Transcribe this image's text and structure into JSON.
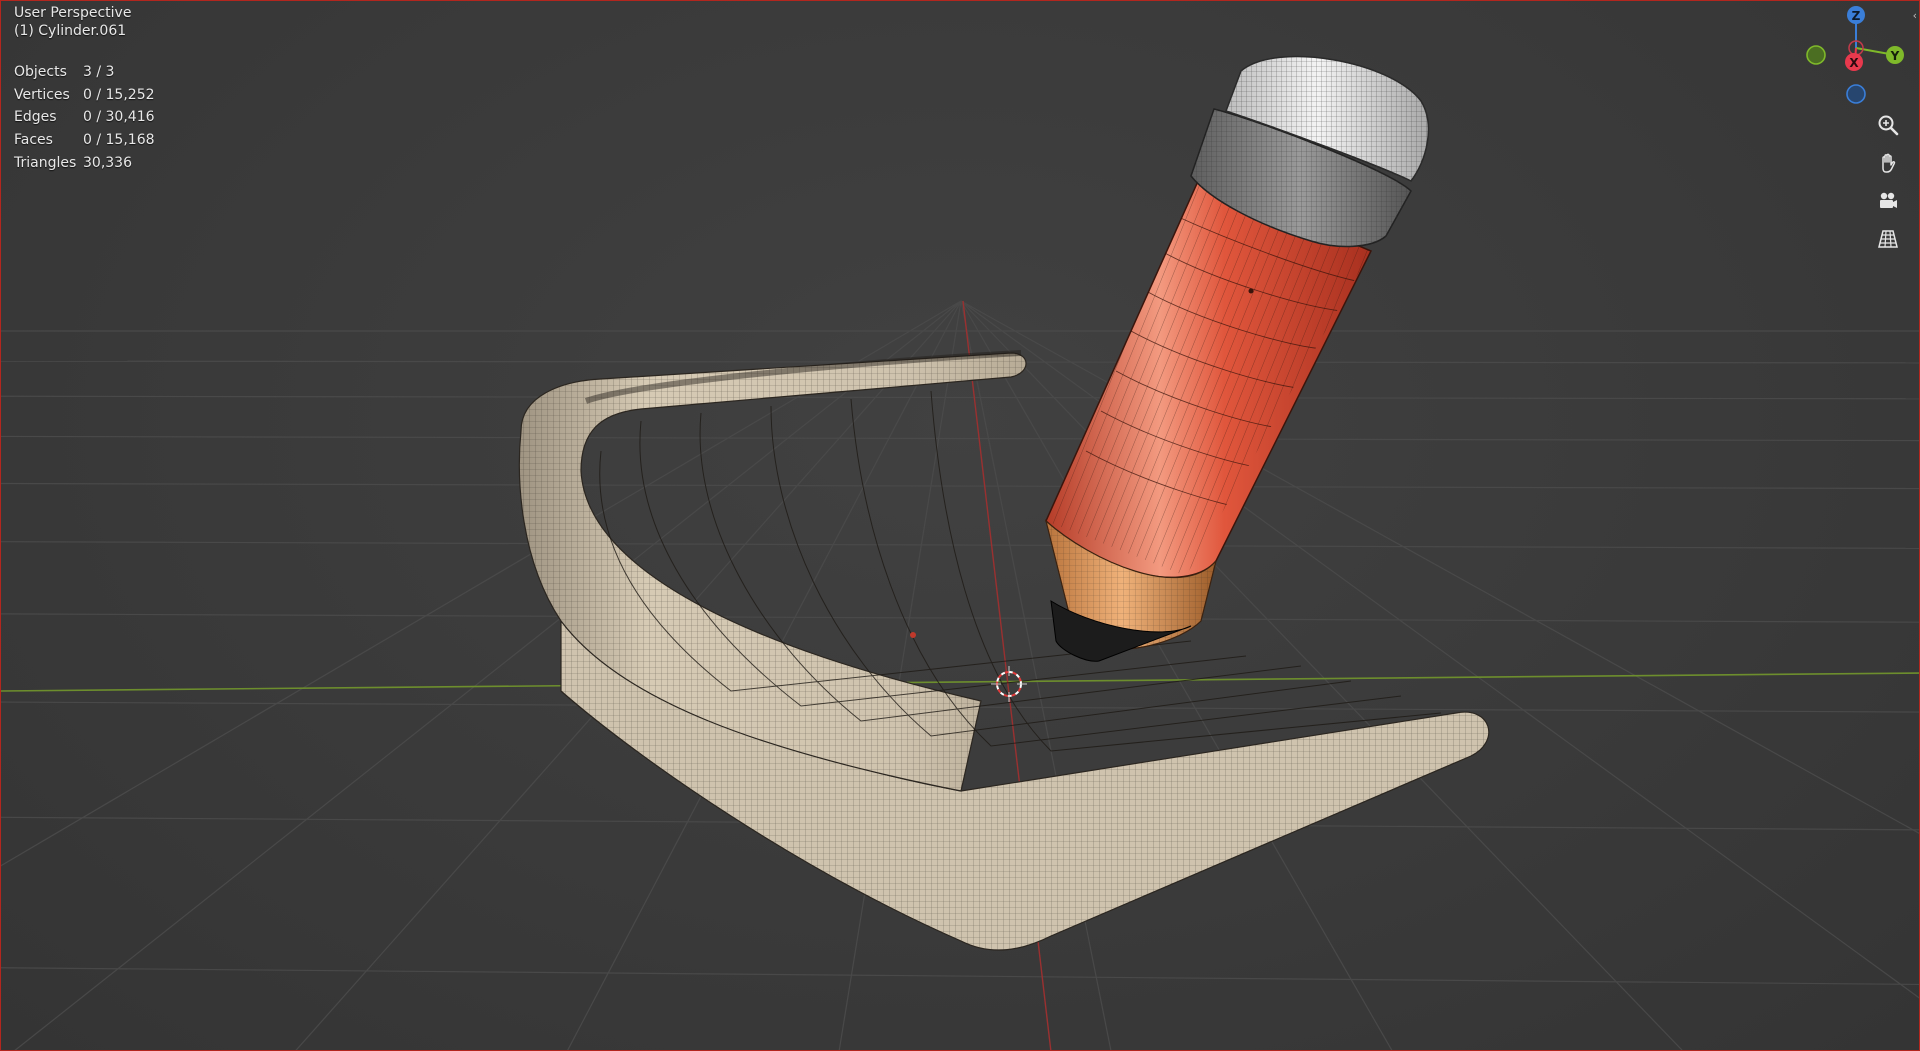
{
  "viewport": {
    "view_name": "User Perspective",
    "active_object": "(1) Cylinder.061"
  },
  "stats": [
    {
      "label": "Objects",
      "value": "3 / 3"
    },
    {
      "label": "Vertices",
      "value": "0 / 15,252"
    },
    {
      "label": "Edges",
      "value": "0 / 30,416"
    },
    {
      "label": "Faces",
      "value": "0 / 15,168"
    },
    {
      "label": "Triangles",
      "value": "30,336"
    }
  ],
  "gizmo": {
    "z_label": "Z",
    "x_label": "X",
    "y_label": "Y",
    "colors": {
      "x": "#e8394d",
      "y": "#7fb92a",
      "z": "#3a7ed8"
    }
  },
  "nav_tools": [
    {
      "name": "zoom-icon"
    },
    {
      "name": "pan-hand-icon"
    },
    {
      "name": "camera-view-icon"
    },
    {
      "name": "orthographic-grid-icon"
    }
  ],
  "scene": {
    "paper_color": "#cfc3ae",
    "pencil_body_color": "#e0563c",
    "pencil_wood_color": "#d9955a",
    "pencil_eraser_color": "#e4e4e4",
    "grid_color": "#4a4a4a",
    "x_axis_color": "#6d8e2d",
    "y_axis_color": "#9a3030"
  }
}
